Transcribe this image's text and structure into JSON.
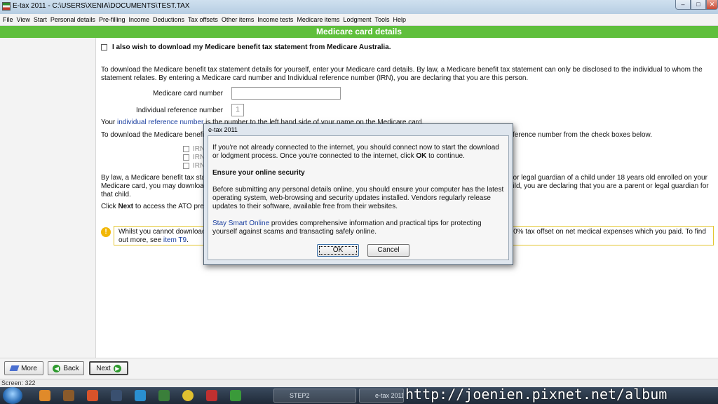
{
  "window": {
    "title": "E-tax 2011 - C:\\USERS\\XENIA\\DOCUMENTS\\TEST.TAX",
    "min": "–",
    "max": "□",
    "close": "✕"
  },
  "menu": [
    "File",
    "View",
    "Start",
    "Personal details",
    "Pre-filling",
    "Income",
    "Deductions",
    "Tax offsets",
    "Other items",
    "Income tests",
    "Medicare items",
    "Lodgment",
    "Tools",
    "Help"
  ],
  "header": {
    "title": "Medicare card details"
  },
  "main": {
    "download_label": "I also wish to download my Medicare benefit tax statement from Medicare Australia.",
    "para1": "To download the Medicare benefit tax statement details for yourself, enter your Medicare card details. By law, a Medicare benefit tax statement can only be disclosed to the individual to whom the statement relates. By entering a Medicare card number and Individual reference number (IRN), you are declaring that you are this person.",
    "card_number_label": "Medicare card number",
    "card_number_value": "",
    "irn_label": "Individual reference number",
    "irn_value": "1",
    "your_prefix": "Your ",
    "your_link": "individual reference number",
    "your_suffix": " is the number to the left hand side of your name on the Medicare card.",
    "others_line": "To download the Medicare benefit tax statement details for others on your Medicare card under 18 years old, select their individual reference number from the check boxes below.",
    "irn_options": [
      "IRN",
      "IRN",
      "IRN"
    ],
    "law_para": "By law, a Medicare benefit tax statement can only be disclosed to the individual to whom the statement relates, or if you are a parent or legal guardian of a child under 18 years old enrolled on your Medicare card, you may download the Medicare benefit tax statement for that child. By listing an individual reference number for a child, you are declaring that you are a parent or legal guardian for that child.",
    "click_prefix": "Click ",
    "click_bold": "Next",
    "click_suffix": " to access the ATO pre-filling service.",
    "info_text": "Whilst you cannot download Medicare benefit tax statement information for people on other cards, you may be able to claim a 20% tax offset on net medical expenses which you paid. To find out more, see ",
    "info_link": "item T9",
    "info_end": "."
  },
  "nav": {
    "more": "More",
    "back": "Back",
    "next": "Next"
  },
  "status": {
    "text": "Screen: 322"
  },
  "taskbar": {
    "task1": "STEP2",
    "task2": "e-tax 2011"
  },
  "watermark": "http://joenien.pixnet.net/album",
  "dialog": {
    "title": "e-tax 2011",
    "p1_a": "If you're not already connected to the internet, you should connect now to start the download or lodgment process. Once you're connected to the internet, click ",
    "p1_b": "OK",
    "p1_c": " to continue.",
    "heading": "Ensure your online security",
    "p2": "Before submitting any personal details online, you should ensure your computer has the latest operating system, web-browsing and security updates installed. Vendors regularly release updates to their software, available free from their websites.",
    "p3_link": "Stay Smart Online",
    "p3_rest": " provides comprehensive information and practical tips for protecting yourself against scams and transacting safely online.",
    "ok": "OK",
    "cancel": "Cancel"
  }
}
